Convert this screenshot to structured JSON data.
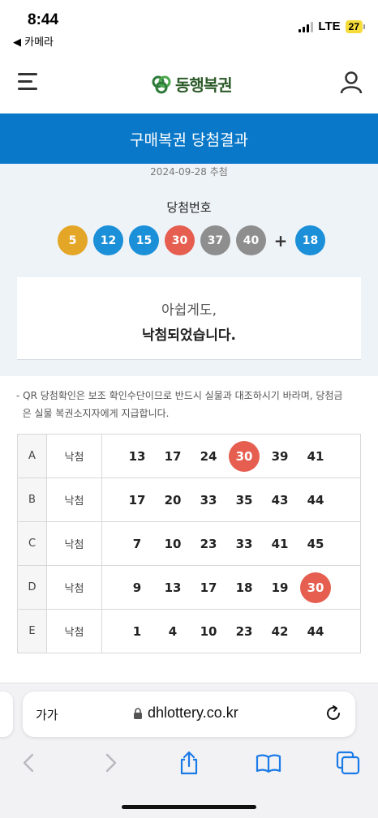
{
  "status": {
    "time": "8:44",
    "back_label": "◀ 카메라",
    "network": "LTE",
    "battery": "27"
  },
  "header": {
    "logo_text": "동행복권"
  },
  "page": {
    "title": "구매복권 당첨결과"
  },
  "draw": {
    "date_label": "2024-09-28 추첨",
    "winning_label": "당첨번호",
    "numbers": [
      {
        "value": "5",
        "color": "#e4a626"
      },
      {
        "value": "12",
        "color": "#1b8fd8"
      },
      {
        "value": "15",
        "color": "#1b8fd8"
      },
      {
        "value": "30",
        "color": "#e55e4f"
      },
      {
        "value": "37",
        "color": "#8e8e8e"
      },
      {
        "value": "40",
        "color": "#8e8e8e"
      }
    ],
    "plus": "+",
    "bonus": {
      "value": "18",
      "color": "#1b8fd8"
    }
  },
  "result": {
    "line1": "아쉽게도,",
    "line2": "낙첨되었습니다."
  },
  "notice": {
    "line1": "- QR 당첨확인은 보조 확인수단이므로 반드시 실물과 대조하시기 바라며, 당첨금",
    "line2": "  은 실물 복권소지자에게 지급합니다."
  },
  "tickets": [
    {
      "slot": "A",
      "result": "낙첨",
      "numbers": [
        "13",
        "17",
        "24",
        "30",
        "39",
        "41"
      ],
      "hits": [
        false,
        false,
        false,
        true,
        false,
        false
      ]
    },
    {
      "slot": "B",
      "result": "낙첨",
      "numbers": [
        "17",
        "20",
        "33",
        "35",
        "43",
        "44"
      ],
      "hits": [
        false,
        false,
        false,
        false,
        false,
        false
      ]
    },
    {
      "slot": "C",
      "result": "낙첨",
      "numbers": [
        "7",
        "10",
        "23",
        "33",
        "41",
        "45"
      ],
      "hits": [
        false,
        false,
        false,
        false,
        false,
        false
      ]
    },
    {
      "slot": "D",
      "result": "낙첨",
      "numbers": [
        "9",
        "13",
        "17",
        "18",
        "19",
        "30"
      ],
      "hits": [
        false,
        false,
        false,
        false,
        false,
        true
      ]
    },
    {
      "slot": "E",
      "result": "낙첨",
      "numbers": [
        "1",
        "4",
        "10",
        "23",
        "42",
        "44"
      ],
      "hits": [
        false,
        false,
        false,
        false,
        false,
        false
      ]
    }
  ],
  "browser": {
    "aa_label": "가가",
    "url": "dhlottery.co.kr"
  },
  "icons": {
    "menu": "hamburger-icon",
    "user": "user-icon",
    "lock": "lock-icon",
    "reload": "reload-icon",
    "back": "chevron-left-icon",
    "forward": "chevron-right-icon",
    "share": "share-icon",
    "bookmarks": "book-icon",
    "tabs": "tabs-icon"
  },
  "colors": {
    "brand_blue": "#0a78c8",
    "hit_red": "#e55e4f",
    "toolbar_blue": "#1a7ae8"
  }
}
